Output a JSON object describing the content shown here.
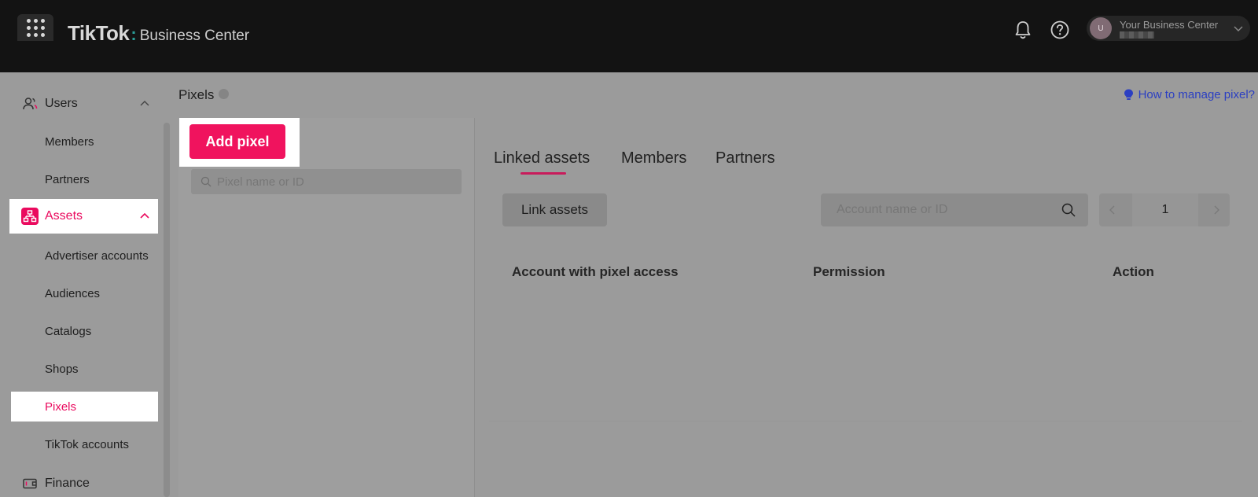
{
  "header": {
    "logo_main": "TikTok",
    "logo_colon": ":",
    "logo_sub": "Business Center",
    "account": {
      "avatar_letter": "U",
      "name": "Your Business Center"
    }
  },
  "sidebar": {
    "users": {
      "label": "Users",
      "items": [
        {
          "label": "Members"
        },
        {
          "label": "Partners"
        }
      ]
    },
    "assets": {
      "label": "Assets",
      "items": [
        {
          "label": "Advertiser accounts"
        },
        {
          "label": "Audiences"
        },
        {
          "label": "Catalogs"
        },
        {
          "label": "Shops"
        },
        {
          "label": "Pixels"
        },
        {
          "label": "TikTok accounts"
        }
      ]
    },
    "finance": {
      "label": "Finance"
    }
  },
  "page": {
    "title": "Pixels",
    "help_link": "How to manage pixel?"
  },
  "left_panel": {
    "add_button": "Add pixel",
    "search_placeholder": "Pixel name or ID"
  },
  "right_panel": {
    "tabs": [
      {
        "label": "Linked assets"
      },
      {
        "label": "Members"
      },
      {
        "label": "Partners"
      }
    ],
    "link_button": "Link assets",
    "search_placeholder": "Account name or ID",
    "page_number": "1",
    "columns": [
      {
        "label": "Account with pixel access"
      },
      {
        "label": "Permission"
      },
      {
        "label": "Action"
      }
    ]
  },
  "colors": {
    "accent": "#ea0a5e",
    "topbar": "#131313",
    "link": "#2b3fc2"
  }
}
